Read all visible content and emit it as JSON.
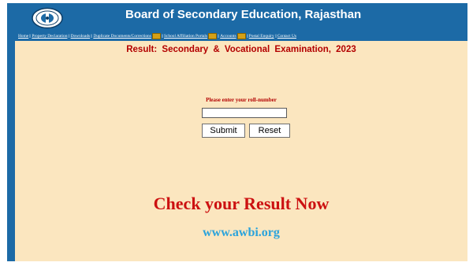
{
  "header": {
    "title": "Board of Secondary Education, Rajasthan",
    "logo_icon": "board-emblem-logo"
  },
  "nav": {
    "items": [
      {
        "label": "Home",
        "new": false
      },
      {
        "label": "Property Declaration",
        "new": false
      },
      {
        "label": "Downloads",
        "new": false
      },
      {
        "label": "Duplicate Documents/Corrections",
        "new": true
      },
      {
        "label": "School Affiliation Portals",
        "new": true
      },
      {
        "label": "Accounts",
        "new": true
      },
      {
        "label": "Postal Enquiry",
        "new": false
      },
      {
        "label": "Contact Us",
        "new": false
      }
    ],
    "separator": "||"
  },
  "main": {
    "result_title": "Result:  Secondary  &  Vocational  Examination,  2023",
    "roll_prompt": "Please enter your roll-number",
    "roll_input_value": "",
    "submit_label": "Submit",
    "reset_label": "Reset",
    "cta_text": "Check your Result Now",
    "site_url": "www.awbi.org"
  },
  "colors": {
    "header_bg": "#1c6aa6",
    "content_bg": "#fbe6bf",
    "title_red": "#b30000",
    "cta_red": "#cc1111",
    "url_blue": "#2aa3dc"
  }
}
